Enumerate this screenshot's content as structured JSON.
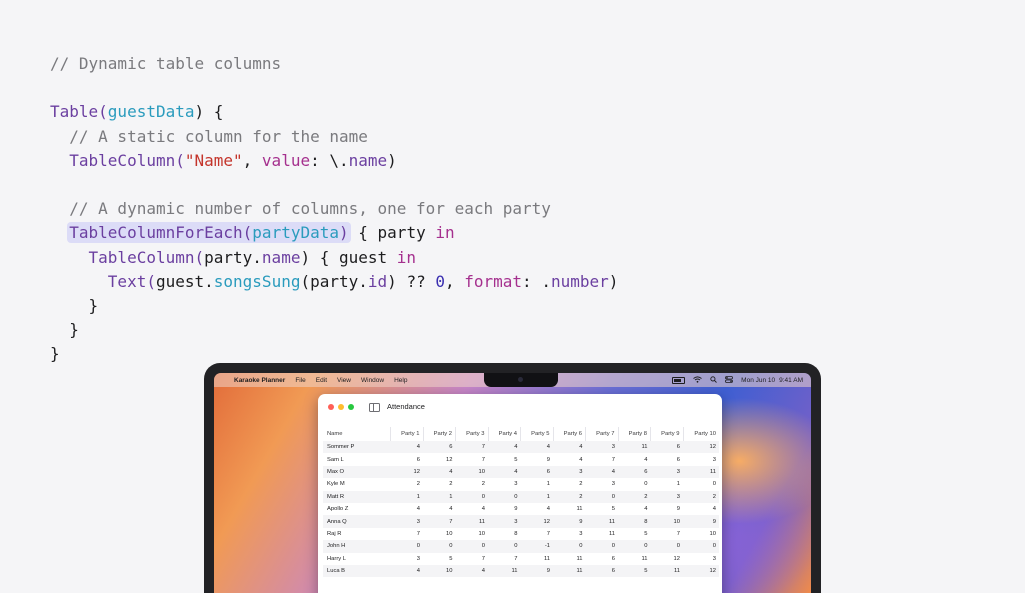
{
  "code": {
    "line1": "// Dynamic table columns",
    "line3a": "Table(",
    "line3b": "guestData",
    "line3c": ") {",
    "line4": "  // A static column for the name",
    "line5a": "TableColumn(",
    "line5b": "\"Name\"",
    "line5c": ", ",
    "line5d": "value",
    "line5e": ": \\.",
    "line5f": "name",
    "line5g": ")",
    "line7": "  // A dynamic number of columns, one for each party",
    "line8a": "TableColumnForEach(",
    "line8b": "partyData",
    "line8c": ")",
    "line8d": " { party ",
    "line8e": "in",
    "line9a": "TableColumn(",
    "line9b": "party.",
    "line9c": "name",
    "line9d": ") { guest ",
    "line9e": "in",
    "line10a": "Text(",
    "line10b": "guest.",
    "line10c": "songsSung",
    "line10d": "(party.",
    "line10e": "id",
    "line10f": ") ?? ",
    "line10g": "0",
    "line10h": ", ",
    "line10i": "format",
    "line10j": ": .",
    "line10k": "number",
    "line10l": ")",
    "line11": "    }",
    "line12": "  }",
    "line13": "}"
  },
  "menubar": {
    "apple": "",
    "app_name": "Karaoke Planner",
    "menus": [
      "File",
      "Edit",
      "View",
      "Window",
      "Help"
    ],
    "date": "Mon Jun 10",
    "time": "9:41 AM",
    "icons": [
      "battery-icon",
      "wifi-icon",
      "search-icon",
      "control-center-icon"
    ]
  },
  "window": {
    "title": "Attendance",
    "columns": [
      "Name",
      "Party 1",
      "Party 2",
      "Party 3",
      "Party 4",
      "Party 5",
      "Party 6",
      "Party 7",
      "Party 8",
      "Party 9",
      "Party 10"
    ],
    "rows": [
      [
        "Sommer P",
        "4",
        "6",
        "7",
        "4",
        "4",
        "4",
        "3",
        "11",
        "6",
        "12"
      ],
      [
        "Sam L",
        "6",
        "12",
        "7",
        "5",
        "9",
        "4",
        "7",
        "4",
        "6",
        "3"
      ],
      [
        "Max O",
        "12",
        "4",
        "10",
        "4",
        "6",
        "3",
        "4",
        "6",
        "3",
        "11"
      ],
      [
        "Kyle M",
        "2",
        "2",
        "2",
        "3",
        "1",
        "2",
        "3",
        "0",
        "1",
        "0"
      ],
      [
        "Matt R",
        "1",
        "1",
        "0",
        "0",
        "1",
        "2",
        "0",
        "2",
        "3",
        "2"
      ],
      [
        "Apollo Z",
        "4",
        "4",
        "4",
        "9",
        "4",
        "11",
        "5",
        "4",
        "9",
        "4"
      ],
      [
        "Anna Q",
        "3",
        "7",
        "11",
        "3",
        "12",
        "9",
        "11",
        "8",
        "10",
        "9"
      ],
      [
        "Raj R",
        "7",
        "10",
        "10",
        "8",
        "7",
        "3",
        "11",
        "5",
        "7",
        "10"
      ],
      [
        "John H",
        "0",
        "0",
        "0",
        "0",
        "-1",
        "0",
        "0",
        "0",
        "0",
        "0"
      ],
      [
        "Harry L",
        "3",
        "5",
        "7",
        "7",
        "11",
        "11",
        "6",
        "11",
        "12",
        "3"
      ],
      [
        "Luca B",
        "4",
        "10",
        "4",
        "11",
        "9",
        "11",
        "6",
        "5",
        "11",
        "12"
      ]
    ]
  },
  "colors": {
    "comment": "#7a7a7e",
    "keyword": "#a5308e",
    "type": "#6b3fa0",
    "parameter": "#2a9bbd",
    "string": "#c4342b",
    "number": "#3a2fb0",
    "highlight": "#dcdcf7"
  }
}
